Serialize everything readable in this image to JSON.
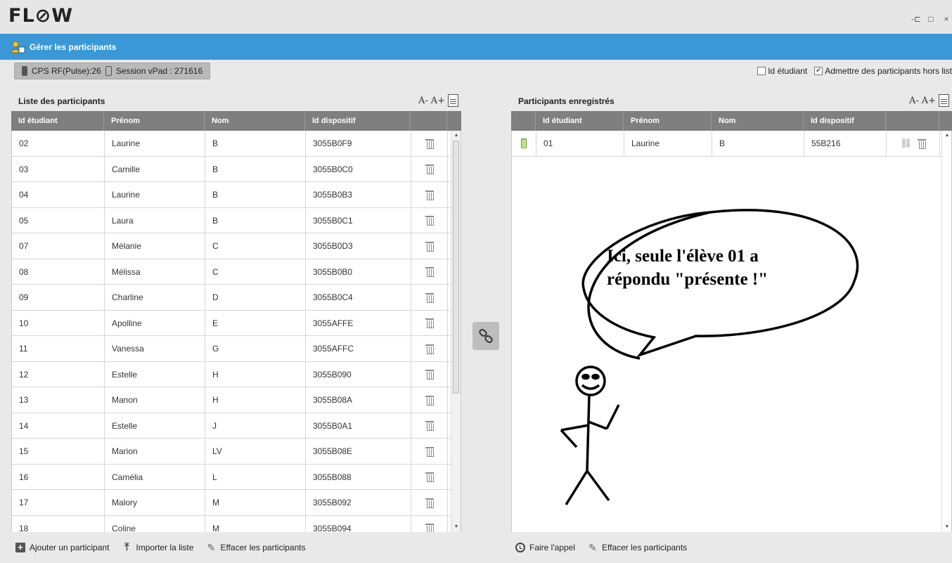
{
  "app": {
    "logo": "FL⊘W",
    "window_controls": [
      "-⊏",
      "□",
      "×"
    ]
  },
  "header": {
    "title": "Gérer les participants"
  },
  "infobar": {
    "rf_label": "CPS RF(Pulse):26",
    "session_label": "Session vPad : 271616",
    "checkbox_id": {
      "label": "Id étudiant",
      "checked": false
    },
    "checkbox_admit": {
      "label": "Admettre des participants hors list",
      "checked": true
    }
  },
  "left": {
    "title": "Liste des participants",
    "font_decrease": "A-",
    "font_increase": "A+",
    "columns": [
      "Id étudiant",
      "Prénom",
      "Nom",
      "Id dispositif",
      ""
    ],
    "rows": [
      [
        "02",
        "Laurine",
        "B",
        "3055B0F9"
      ],
      [
        "03",
        "Camille",
        "B",
        "3055B0C0"
      ],
      [
        "04",
        "Laurine",
        "B",
        "3055B0B3"
      ],
      [
        "05",
        "Laura",
        "B",
        "3055B0C1"
      ],
      [
        "07",
        "Mélanie",
        "C",
        "3055B0D3"
      ],
      [
        "08",
        "Mélissa",
        "C",
        "3055B0B0"
      ],
      [
        "09",
        "Charline",
        "D",
        "3055B0C4"
      ],
      [
        "10",
        "Apolline",
        "E",
        "3055AFFE"
      ],
      [
        "11",
        "Vanessa",
        "G",
        "3055AFFC"
      ],
      [
        "12",
        "Estelle",
        "H",
        "3055B090"
      ],
      [
        "13",
        "Manon",
        "H",
        "3055B08A"
      ],
      [
        "14",
        "Estelle",
        "J",
        "3055B0A1"
      ],
      [
        "15",
        "Marion",
        "LV",
        "3055B08E"
      ],
      [
        "16",
        "Camélia",
        "L",
        "3055B088"
      ],
      [
        "17",
        "Malory",
        "M",
        "3055B092"
      ],
      [
        "18",
        "Coline",
        "M",
        "3055B094"
      ]
    ],
    "footer": {
      "add": "Ajouter un participant",
      "import": "Importer la liste",
      "clear": "Effacer les participants"
    }
  },
  "right": {
    "title": "Participants enregistrés",
    "font_decrease": "A-",
    "font_increase": "A+",
    "columns": [
      "",
      "Id étudiant",
      "Prénom",
      "Nom",
      "Id dispositif",
      ""
    ],
    "rows": [
      [
        "01",
        "Laurine",
        "B",
        "55B216"
      ]
    ],
    "footer": {
      "call": "Faire l'appel",
      "clear": "Effacer les participants"
    }
  },
  "annotation": {
    "line1": "Ici, seule l'élève 01 a",
    "line2": "répondu \"présente !\""
  },
  "colors": {
    "header_blue": "#3a98d6",
    "table_header_gray": "#7f7f7f",
    "battery_green": "#6ea232"
  }
}
